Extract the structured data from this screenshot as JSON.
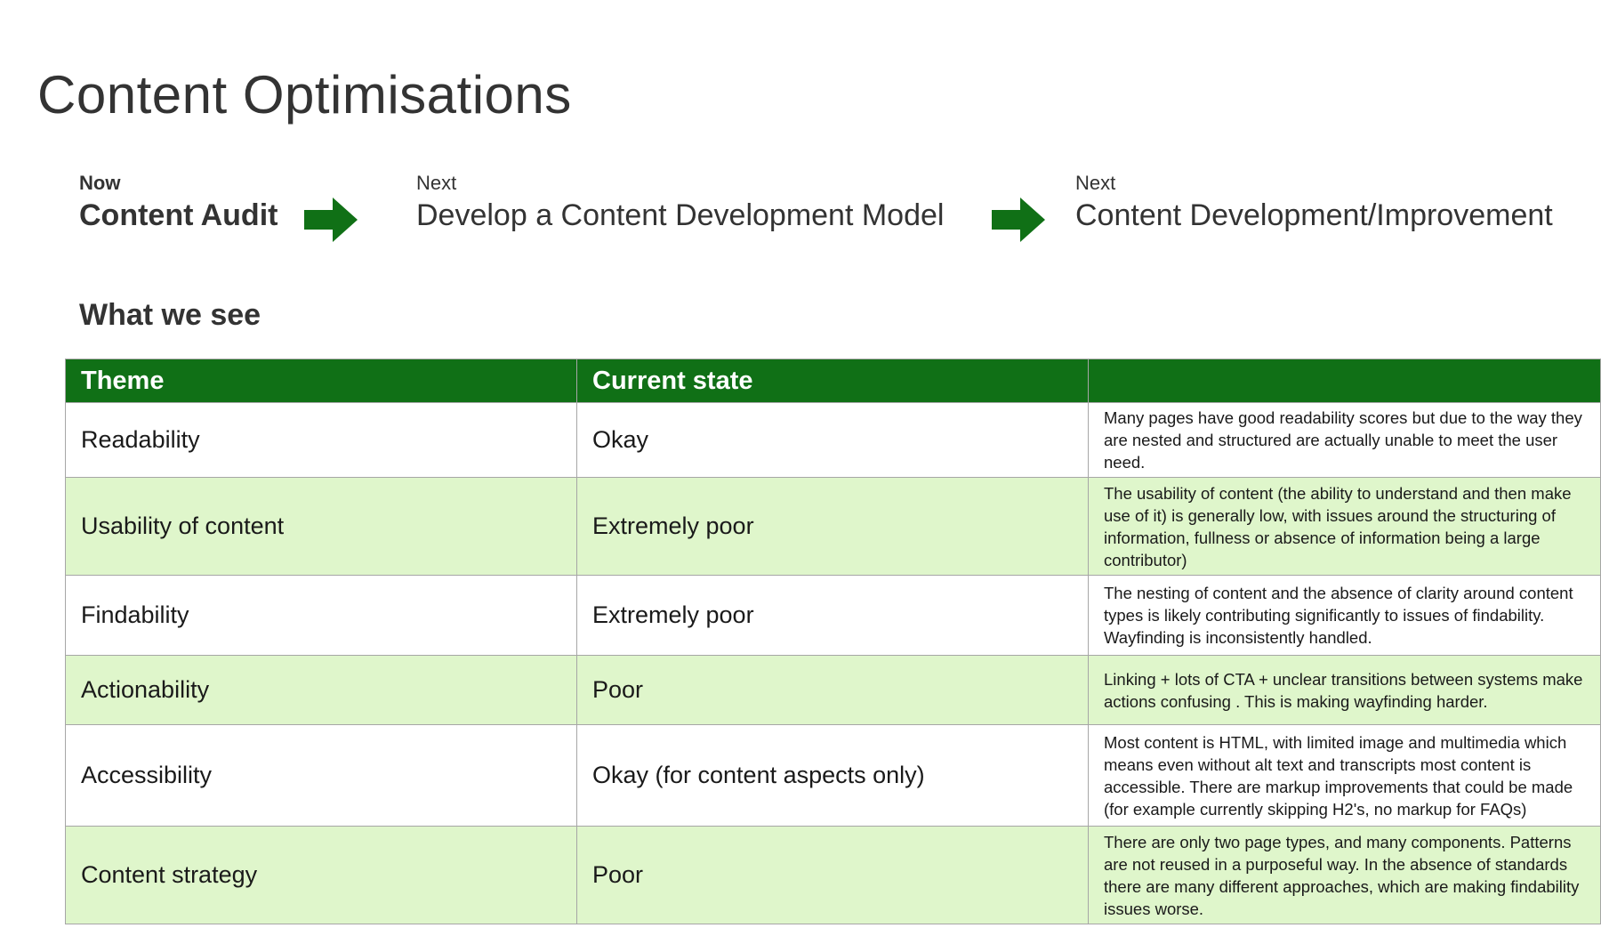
{
  "title": "Content Optimisations",
  "stages": [
    {
      "label": "Now",
      "name": "Content Audit"
    },
    {
      "label": "Next",
      "name": "Develop a Content Development Model"
    },
    {
      "label": "Next",
      "name": "Content Development/Improvement"
    }
  ],
  "arrow_color": "#107016",
  "section_heading": "What we see",
  "table": {
    "headers": [
      "Theme",
      "Current state",
      ""
    ],
    "rows": [
      {
        "theme": "Readability",
        "state": "Okay",
        "description": "Many pages have good readability scores but due to the way they are nested and structured are actually unable to meet the user need."
      },
      {
        "theme": "Usability of content",
        "state": "Extremely poor",
        "description": "The usability of content (the ability to understand and then make use of it) is generally low, with issues around the structuring of information, fullness or absence of information being a large contributor)"
      },
      {
        "theme": "Findability",
        "state": "Extremely poor",
        "description": "The nesting of content and the absence of clarity around content types is likely contributing significantly to issues of findability. Wayfinding is inconsistently handled."
      },
      {
        "theme": "Actionability",
        "state": "Poor",
        "description": "Linking + lots of CTA + unclear transitions between systems make actions confusing . This is making wayfinding harder."
      },
      {
        "theme": "Accessibility",
        "state": "Okay (for content aspects only)",
        "description": "Most content is HTML, with limited image and multimedia which means even without alt text and transcripts most content is accessible. There are markup improvements that could be made (for example currently skipping H2's, no markup for FAQs)"
      },
      {
        "theme": "Content strategy",
        "state": "Poor",
        "description": "There are only two page types, and many components. Patterns are not reused in a purposeful way. In the absence of standards there are many different approaches, which are making findability issues worse."
      }
    ],
    "header_color": "#107016",
    "alt_row_color": "#dff6cb"
  }
}
